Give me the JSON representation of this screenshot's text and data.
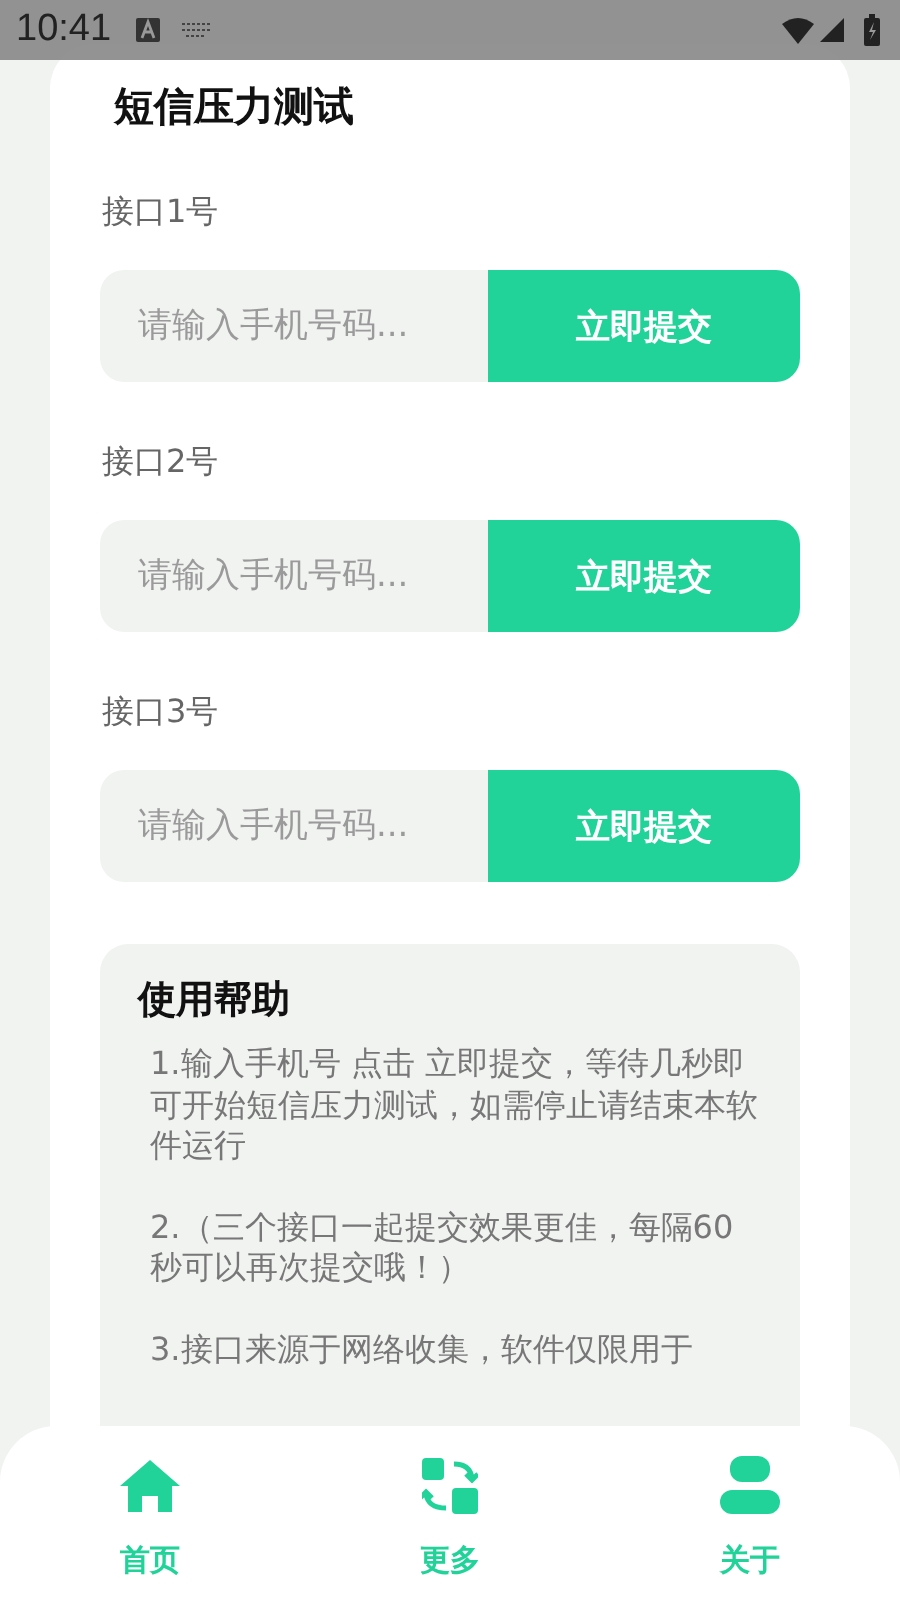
{
  "status_bar": {
    "time": "10:41"
  },
  "title": "短信压力测试",
  "interfaces": [
    {
      "label": "接口1号",
      "placeholder": "请输入手机号码...",
      "button": "立即提交"
    },
    {
      "label": "接口2号",
      "placeholder": "请输入手机号码...",
      "button": "立即提交"
    },
    {
      "label": "接口3号",
      "placeholder": "请输入手机号码...",
      "button": "立即提交"
    }
  ],
  "help": {
    "title": "使用帮助",
    "paragraphs": [
      "1.输入手机号 点击 立即提交，等待几秒即可开始短信压力测试，如需停止请结束本软件运行",
      "2.（三个接口一起提交效果更佳，每隔60秒可以再次提交哦！）",
      "3.接口来源于网络收集，软件仅限用于"
    ]
  },
  "nav": [
    {
      "kind": "home",
      "label": "首页"
    },
    {
      "kind": "more",
      "label": "更多"
    },
    {
      "kind": "about",
      "label": "关于"
    }
  ]
}
